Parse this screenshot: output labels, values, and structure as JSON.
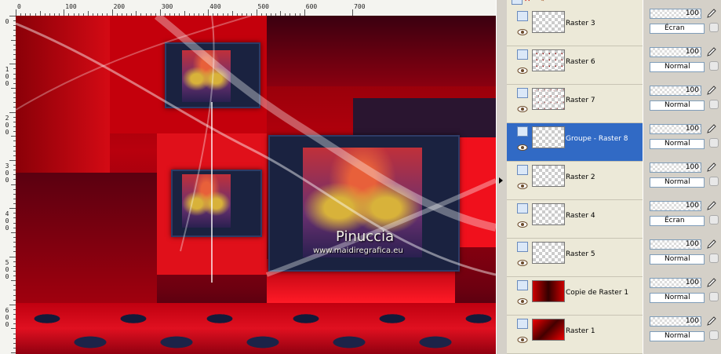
{
  "rulers": {
    "top_labels": [
      "0",
      "100",
      "200",
      "300",
      "400",
      "500",
      "600",
      "700"
    ],
    "left_labels": [
      [
        "0"
      ],
      [
        "1",
        "0",
        "0"
      ],
      [
        "2",
        "0",
        "0"
      ],
      [
        "3",
        "0",
        "0"
      ],
      [
        "4",
        "0",
        "0"
      ],
      [
        "5",
        "0",
        "0"
      ],
      [
        "6",
        "0",
        "0"
      ]
    ]
  },
  "canvas": {
    "watermark_title": "Pinuccia",
    "watermark_url": "www.maidiregrafica.eu"
  },
  "layers": [
    {
      "name": "Raster 3",
      "opacity": "100",
      "blend": "Écran",
      "selected": false
    },
    {
      "name": "Raster 6",
      "opacity": "100",
      "blend": "Normal",
      "selected": false
    },
    {
      "name": "Raster 7",
      "opacity": "100",
      "blend": "Normal",
      "selected": false
    },
    {
      "name": "Groupe - Raster 8",
      "opacity": "100",
      "blend": "Normal",
      "selected": true
    },
    {
      "name": "Raster 2",
      "opacity": "100",
      "blend": "Normal",
      "selected": false
    },
    {
      "name": "Raster 4",
      "opacity": "100",
      "blend": "Écran",
      "selected": false
    },
    {
      "name": "Raster 5",
      "opacity": "100",
      "blend": "Normal",
      "selected": false
    },
    {
      "name": "Copie de Raster 1",
      "opacity": "100",
      "blend": "Normal",
      "selected": false
    },
    {
      "name": "Raster 1",
      "opacity": "100",
      "blend": "Normal",
      "selected": false
    }
  ],
  "icons": {
    "layer_toggle": "layer-visibility-toggle-icon",
    "eye": "eye-icon",
    "pen": "pen-icon",
    "lock": "lock-icon"
  }
}
